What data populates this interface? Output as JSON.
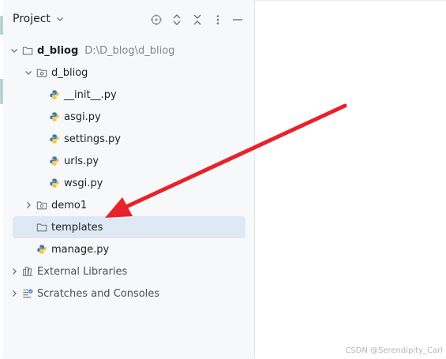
{
  "panel": {
    "title": "Project",
    "tools": [
      "locate-icon",
      "expand-all-icon",
      "collapse-all-icon",
      "more-icon",
      "minimize-icon"
    ]
  },
  "tree": {
    "root": {
      "label": "d_bliog",
      "path": "D:\\D_blog\\d_bliog"
    },
    "pkg": {
      "label": "d_bliog"
    },
    "files": [
      "__init__.py",
      "asgi.py",
      "settings.py",
      "urls.py",
      "wsgi.py"
    ],
    "demo": {
      "label": "demo1"
    },
    "templates": {
      "label": "templates"
    },
    "manage": {
      "label": "manage.py"
    },
    "external": {
      "label": "External Libraries"
    },
    "scratches": {
      "label": "Scratches and Consoles"
    }
  },
  "watermark": "CSDN @Serendipity_Carl",
  "colors": {
    "selection": "#dfe9f5",
    "arrow": "#e8222b",
    "python_blue": "#3b78b4",
    "python_yellow": "#f2c53d"
  }
}
